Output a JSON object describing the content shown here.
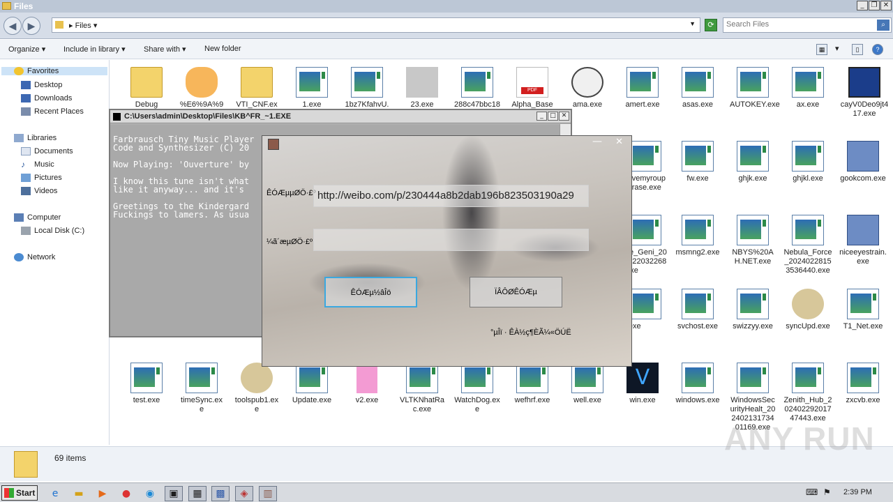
{
  "explorer": {
    "title": "Files",
    "path_label": "Files",
    "search_placeholder": "Search Files",
    "toolbar": {
      "organize": "Organize",
      "include_library": "Include in library",
      "share_with": "Share with",
      "new_folder": "New folder"
    },
    "nav": {
      "favorites": "Favorites",
      "desktop": "Desktop",
      "downloads": "Downloads",
      "recent_places": "Recent Places",
      "libraries": "Libraries",
      "documents": "Documents",
      "music": "Music",
      "pictures": "Pictures",
      "videos": "Videos",
      "computer": "Computer",
      "local_disk": "Local Disk (C:)",
      "network": "Network"
    },
    "files": [
      {
        "name": "Debug",
        "icon": "folder-icon"
      },
      {
        "name": "%E6%9A%9",
        "icon": "cat-icon"
      },
      {
        "name": "VTI_CNF.ex",
        "icon": "folder-icon"
      },
      {
        "name": "1.exe",
        "icon": "exe-icon"
      },
      {
        "name": "1bz7KfahvU.",
        "icon": "exe-icon"
      },
      {
        "name": "23.exe",
        "icon": "blurred-icon"
      },
      {
        "name": "288c47bbc18",
        "icon": "exe-icon"
      },
      {
        "name": "Alpha_Base",
        "icon": "pdf-icon"
      },
      {
        "name": "ama.exe",
        "icon": "dial-icon"
      },
      {
        "name": "amert.exe",
        "icon": "exe-icon"
      },
      {
        "name": "asas.exe",
        "icon": "exe-icon"
      },
      {
        "name": "AUTOKEY.exe",
        "icon": "exe-icon"
      },
      {
        "name": "ax.exe",
        "icon": "exe-icon"
      },
      {
        "name": "cayV0Deo9jt417.exe",
        "icon": "monitor-icon"
      },
      {
        "name": "shovemyroupyourase.exe",
        "icon": "exe-icon"
      },
      {
        "name": "fw.exe",
        "icon": "exe-icon"
      },
      {
        "name": "ghjk.exe",
        "icon": "exe-icon"
      },
      {
        "name": "ghjkl.exe",
        "icon": "exe-icon"
      },
      {
        "name": "gookcom.exe",
        "icon": "installer-icon"
      },
      {
        "name": "acle_Geni_20240220322680.exe",
        "icon": "exe-icon"
      },
      {
        "name": "msmng2.exe",
        "icon": "exe-icon"
      },
      {
        "name": "NBYS%20AH.NET.exe",
        "icon": "exe-icon"
      },
      {
        "name": "Nebula_Force_20240228153536440.exe",
        "icon": "exe-icon"
      },
      {
        "name": "niceeyestrain.exe",
        "icon": "installer-icon"
      },
      {
        "name": "trt.exe",
        "icon": "exe-icon"
      },
      {
        "name": "svchost.exe",
        "icon": "exe-icon"
      },
      {
        "name": "swizzyy.exe",
        "icon": "exe-icon"
      },
      {
        "name": "syncUpd.exe",
        "icon": "speech-icon"
      },
      {
        "name": "T1_Net.exe",
        "icon": "exe-icon"
      },
      {
        "name": "test.exe",
        "icon": "exe-icon"
      },
      {
        "name": "timeSync.exe",
        "icon": "exe-icon"
      },
      {
        "name": "toolspub1.exe",
        "icon": "speech-icon"
      },
      {
        "name": "Update.exe",
        "icon": "exe-icon"
      },
      {
        "name": "v2.exe",
        "icon": "bag-icon"
      },
      {
        "name": "VLTKNhatRac.exe",
        "icon": "exe-icon"
      },
      {
        "name": "WatchDog.exe",
        "icon": "exe-icon"
      },
      {
        "name": "wefhrf.exe",
        "icon": "exe-icon"
      },
      {
        "name": "well.exe",
        "icon": "exe-icon"
      },
      {
        "name": "win.exe",
        "icon": "v-icon"
      },
      {
        "name": "windows.exe",
        "icon": "exe-icon"
      },
      {
        "name": "WindowsSecurityHealt_20240213173401169.exe",
        "icon": "exe-icon"
      },
      {
        "name": "Zenith_Hub_20240229201747443.exe",
        "icon": "exe-icon"
      },
      {
        "name": "zxcvb.exe",
        "icon": "exe-icon"
      }
    ],
    "status": "69 items"
  },
  "console": {
    "title": "C:\\Users\\admin\\Desktop\\Files\\KB^FR_~1.EXE",
    "lines": "Farbrausch Tiny Music Player\nCode and Synthesizer (C) 20\n\nNow Playing: 'Ouverture' by\n\nI know this tune isn't what\nlike it anyway... and it's\n\nGreetings to the Kindergard\nFuckings to lamers. As usua"
  },
  "popup": {
    "label_url": "ÊÓÆµµØÖ·£º",
    "url_value": "http://weibo.com/p/230444a8b2dab196b823503190a29",
    "label_save": "¼ã´æµØÖ·£º",
    "save_value": "",
    "btn_parse": "ÊÓÆµ½âÎö",
    "btn_download": "ÏÂÔØÊÓÆµ",
    "status": "°µÎï · ÊÀ½ç¶ÈÃ¼«ÖÚË"
  },
  "taskbar": {
    "start": "Start",
    "clock": "2:39 PM"
  },
  "watermark": "ANY RUN"
}
